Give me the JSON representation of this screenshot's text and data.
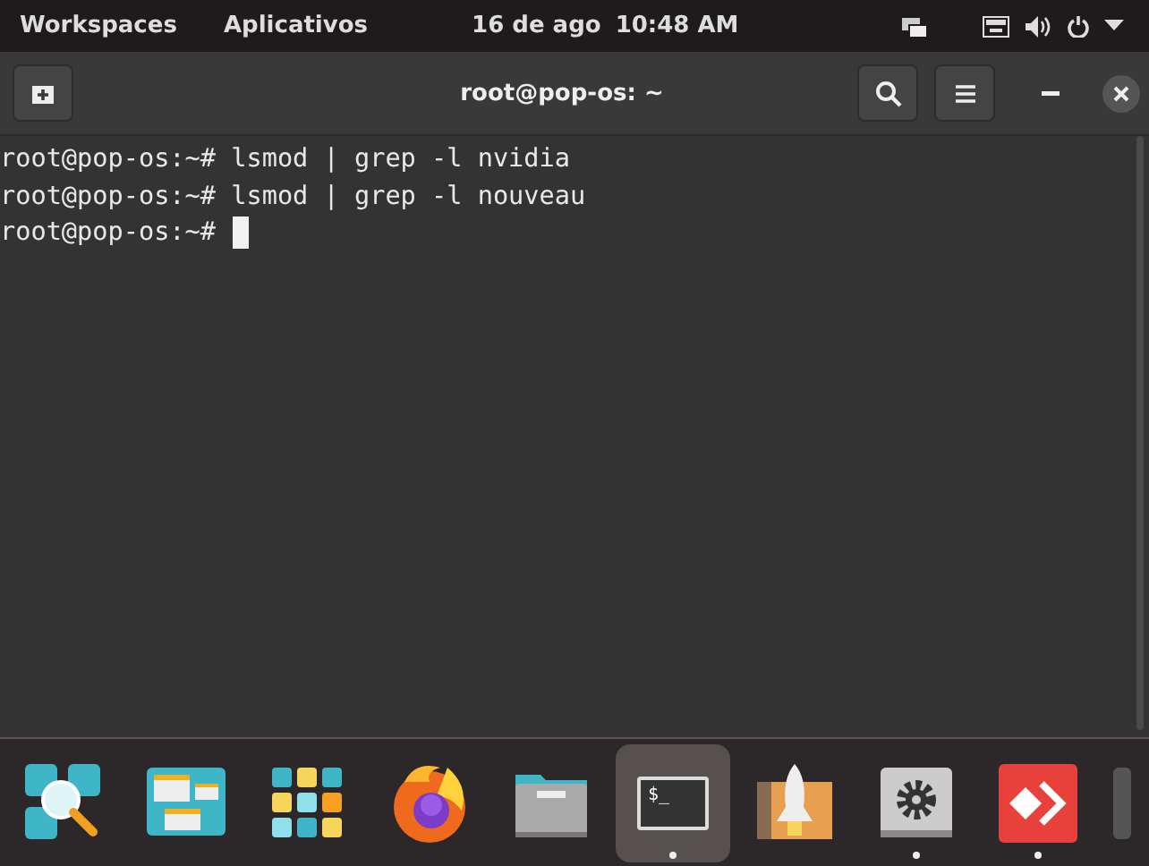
{
  "top_bar": {
    "workspaces": "Workspaces",
    "applications": "Aplicativos",
    "date": "16 de ago",
    "time": "10:48 AM"
  },
  "window": {
    "title": "root@pop-os: ~"
  },
  "terminal": {
    "lines": [
      {
        "prompt": "root@pop-os:~#",
        "command": "lsmod | grep -l nvidia"
      },
      {
        "prompt": "root@pop-os:~#",
        "command": "lsmod | grep -l nouveau"
      },
      {
        "prompt": "root@pop-os:~#",
        "cursor": true
      }
    ]
  },
  "dock": [
    {
      "kind": "search",
      "running": false,
      "selected": false
    },
    {
      "kind": "workspaces",
      "running": false,
      "selected": false
    },
    {
      "kind": "apps",
      "running": false,
      "selected": false
    },
    {
      "kind": "browser",
      "running": false,
      "selected": false
    },
    {
      "kind": "files",
      "running": false,
      "selected": false
    },
    {
      "kind": "terminal",
      "glyph": "$_",
      "running": true,
      "selected": true
    },
    {
      "kind": "store",
      "running": false,
      "selected": false
    },
    {
      "kind": "settings",
      "running": true,
      "selected": false
    },
    {
      "kind": "remote",
      "running": true,
      "selected": false
    },
    {
      "kind": "partial",
      "running": false,
      "selected": false
    }
  ]
}
